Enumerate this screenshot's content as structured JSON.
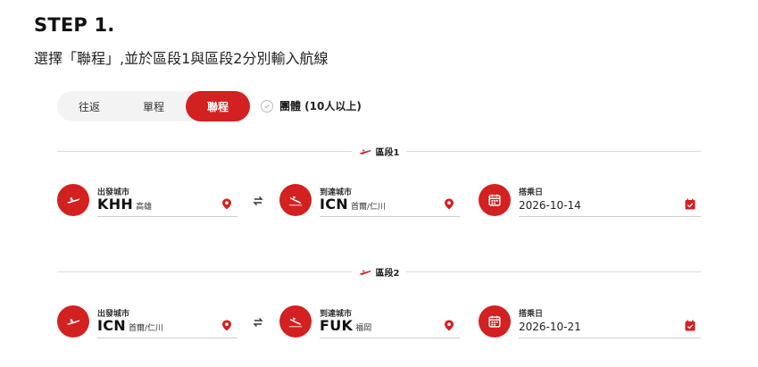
{
  "header": {
    "step": "STEP 1.",
    "description": "選擇「聯程」,並於區段1與區段2分別輸入航線"
  },
  "trip_type": {
    "tabs": [
      "往返",
      "單程",
      "聯程"
    ],
    "active_index": 2
  },
  "group_option": {
    "label": "團體 (10人以上)",
    "checked": false
  },
  "segments": [
    {
      "label": "區段1",
      "departure": {
        "label": "出發城市",
        "code": "KHH",
        "city": "高雄"
      },
      "arrival": {
        "label": "到達城市",
        "code": "ICN",
        "city": "首爾/仁川"
      },
      "date": {
        "label": "搭乘日",
        "value": "2026-10-14"
      }
    },
    {
      "label": "區段2",
      "departure": {
        "label": "出發城市",
        "code": "ICN",
        "city": "首爾/仁川"
      },
      "arrival": {
        "label": "到達城市",
        "code": "FUK",
        "city": "福岡"
      },
      "date": {
        "label": "搭乘日",
        "value": "2026-10-21"
      }
    }
  ],
  "colors": {
    "accent": "#d32020",
    "divider": "#dcdcdc",
    "tab_bg": "#f3f3f3"
  }
}
